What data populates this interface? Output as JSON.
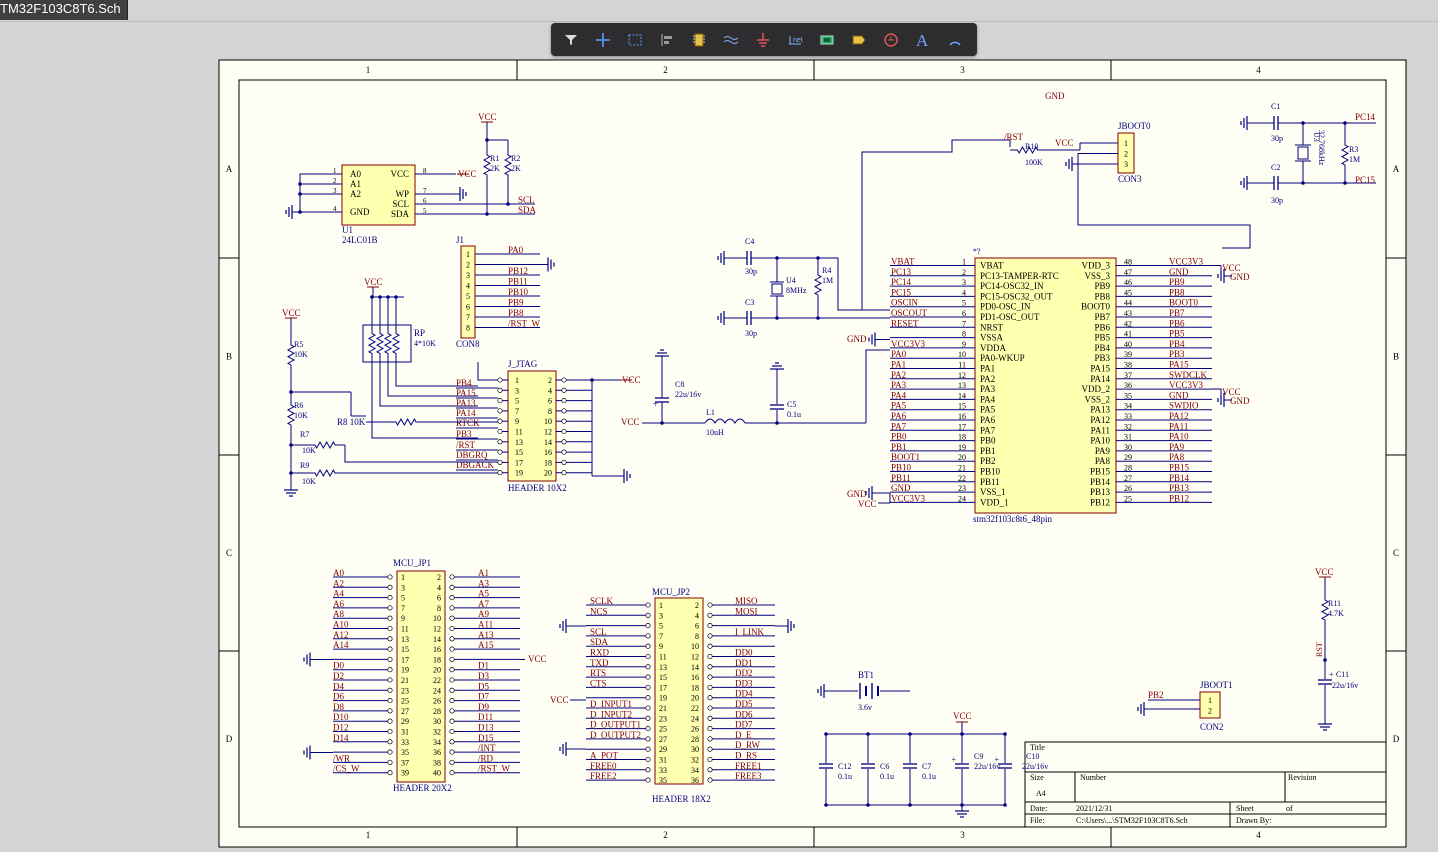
{
  "window": {
    "tab_title": "TM32F103C8T6.Sch"
  },
  "toolbar": {
    "tools": [
      {
        "name": "filter",
        "icon": "filter-icon"
      },
      {
        "name": "place-cross",
        "icon": "crosshair-icon"
      },
      {
        "name": "select-area",
        "icon": "select-rect-icon"
      },
      {
        "name": "align",
        "icon": "align-icon"
      },
      {
        "name": "place-part",
        "icon": "component-icon"
      },
      {
        "name": "place-harness",
        "icon": "signal-harness-icon"
      },
      {
        "name": "place-ground",
        "icon": "ground-icon"
      },
      {
        "name": "place-net-label",
        "icon": "net-label-icon"
      },
      {
        "name": "place-sheet-symbol",
        "icon": "sheet-symbol-icon"
      },
      {
        "name": "place-port",
        "icon": "port-icon"
      },
      {
        "name": "no-erc",
        "icon": "no-erc-icon"
      },
      {
        "name": "place-text",
        "icon": "text-icon"
      },
      {
        "name": "place-arc",
        "icon": "arc-icon"
      }
    ]
  },
  "sheet": {
    "colors": {
      "paper": "#fffef4",
      "border": "#000000",
      "wire": "#000080",
      "part_fill": "#ffffb0",
      "part_text": "#000080",
      "net_text": "#800000",
      "designator": "#000080"
    },
    "zone_columns": [
      "1",
      "2",
      "3",
      "4"
    ],
    "zone_rows": [
      "A",
      "B",
      "C",
      "D"
    ],
    "title_block": {
      "title_label": "Title",
      "size_label": "Size",
      "size_value": "A4",
      "number_label": "Number",
      "revision_label": "Revision",
      "date_label": "Date:",
      "date_value": "2021/12/31",
      "sheet_label": "Sheet",
      "of_label": "of",
      "file_label": "File:",
      "file_value": "C:\\Users\\...\\STM32F103C8T6.Sch",
      "drawn_label": "Drawn By:"
    },
    "labels": {
      "gnd_top": "GND",
      "u1_pins_left": [
        {
          "n": "1",
          "s": "A0"
        },
        {
          "n": "2",
          "s": "A1"
        },
        {
          "n": "3",
          "s": "A2"
        },
        {
          "n": "4",
          "s": "GND"
        }
      ],
      "u1_pins_right": [
        {
          "n": "8",
          "s": "VCC"
        },
        {
          "n": "7",
          "s": "WP"
        },
        {
          "n": "6",
          "s": "SCL"
        },
        {
          "n": "5",
          "s": "SDA"
        }
      ],
      "u1_ref": "U1",
      "u1_value": "24LC01B",
      "vcc": "VCC",
      "r1": "R1",
      "r1_val": "2K",
      "r2": "R2",
      "r2_val": "2K",
      "scl": "SCL",
      "sda": "SDA",
      "j1": "J1",
      "j1_value": "CON8",
      "j1_nets": [
        "PA0",
        "PB12",
        "PB11",
        "PB10",
        "PB9",
        "PB8",
        "/RST_W"
      ],
      "j1_pins": [
        "1",
        "2",
        "3",
        "4",
        "5",
        "6",
        "7",
        "8"
      ],
      "rp": "RP",
      "rp_val": "4*10K",
      "r5": "R5",
      "r5_val": "10K",
      "r6": "R6",
      "r6_val": "10K",
      "r7": "R7",
      "r7_val": "10K",
      "r8": "R8",
      "r8_val": "10K",
      "r9": "R9",
      "r9_val": "10K",
      "jtag": "J_JTAG",
      "jtag_value": "HEADER 10X2",
      "jtag_left_pins": [
        "1",
        "3",
        "5",
        "7",
        "9",
        "11",
        "13",
        "15",
        "17",
        "19"
      ],
      "jtag_right_pins": [
        "2",
        "4",
        "6",
        "8",
        "10",
        "12",
        "14",
        "16",
        "18",
        "20"
      ],
      "jtag_nets": [
        "PB4",
        "PA15",
        "PA13",
        "PA14",
        "RTCK",
        "PB3",
        "/RST",
        "DBGRQ",
        "DBGACK"
      ],
      "c4": "C4",
      "c4_val": "30p",
      "c3": "C3",
      "c3_val": "30p",
      "u4": "U4",
      "u4_val": "8MHz",
      "r4": "R4",
      "r4_val": "1M",
      "c8": "C8",
      "c8_val": "22u/16v",
      "l1": "L1",
      "l1_val": "10uH",
      "c5": "C5",
      "c5_val": "0.1u",
      "rst_top": "/RST",
      "r10": "R10",
      "r10_val": "100K",
      "jboot0": "JBOOT0",
      "jboot0_value": "CON3",
      "jboot0_pins": [
        "1",
        "2",
        "3"
      ],
      "c1": "C1",
      "c1_val": "30p",
      "c2": "C2",
      "c2_val": "30p",
      "u3": "U3",
      "u3_val": "32.768kHz",
      "r3": "R3",
      "r3_val": "1M",
      "pc14": "PC14",
      "pc15": "PC15",
      "mcu_mark": "*?",
      "mcu_value": "stm32f103c8t6_48pin",
      "mcu_left": [
        {
          "n": "1",
          "s": "VBAT",
          "net": "VBAT"
        },
        {
          "n": "2",
          "s": "PC13-TAMPER-RTC",
          "net": "PC13"
        },
        {
          "n": "3",
          "s": "PC14-OSC32_IN",
          "net": "PC14"
        },
        {
          "n": "4",
          "s": "PC15-OSC32_OUT",
          "net": "PC15"
        },
        {
          "n": "5",
          "s": "PD0-OSC_IN",
          "net": "OSCIN"
        },
        {
          "n": "6",
          "s": "PD1-OSC_OUT",
          "net": "OSCOUT"
        },
        {
          "n": "7",
          "s": "NRST",
          "net": "RESET"
        },
        {
          "n": "8",
          "s": "VSSA",
          "net": ""
        },
        {
          "n": "9",
          "s": "VDDA",
          "net": "VCC3V3"
        },
        {
          "n": "10",
          "s": "PA0-WKUP",
          "net": "PA0"
        },
        {
          "n": "11",
          "s": "PA1",
          "net": "PA1"
        },
        {
          "n": "12",
          "s": "PA2",
          "net": "PA2"
        },
        {
          "n": "13",
          "s": "PA3",
          "net": "PA3"
        },
        {
          "n": "14",
          "s": "PA4",
          "net": "PA4"
        },
        {
          "n": "15",
          "s": "PA5",
          "net": "PA5"
        },
        {
          "n": "16",
          "s": "PA6",
          "net": "PA6"
        },
        {
          "n": "17",
          "s": "PA7",
          "net": "PA7"
        },
        {
          "n": "18",
          "s": "PB0",
          "net": "PB0"
        },
        {
          "n": "19",
          "s": "PB1",
          "net": "PB1"
        },
        {
          "n": "20",
          "s": "PB2",
          "net": "BOOT1"
        },
        {
          "n": "21",
          "s": "PB10",
          "net": "PB10"
        },
        {
          "n": "22",
          "s": "PB11",
          "net": "PB11"
        },
        {
          "n": "23",
          "s": "VSS_1",
          "net": "GND"
        },
        {
          "n": "24",
          "s": "VDD_1",
          "net": "VCC3V3"
        }
      ],
      "mcu_right": [
        {
          "n": "48",
          "s": "VDD_3",
          "net": "VCC3V3"
        },
        {
          "n": "47",
          "s": "VSS_3",
          "net": "GND"
        },
        {
          "n": "46",
          "s": "PB9",
          "net": "PB9"
        },
        {
          "n": "45",
          "s": "PB8",
          "net": "PB8"
        },
        {
          "n": "44",
          "s": "BOOT0",
          "net": "BOOT0"
        },
        {
          "n": "43",
          "s": "PB7",
          "net": "PB7"
        },
        {
          "n": "42",
          "s": "PB6",
          "net": "PB6"
        },
        {
          "n": "41",
          "s": "PB5",
          "net": "PB5"
        },
        {
          "n": "40",
          "s": "PB4",
          "net": "PB4"
        },
        {
          "n": "39",
          "s": "PB3",
          "net": "PB3"
        },
        {
          "n": "38",
          "s": "PA15",
          "net": "PA15"
        },
        {
          "n": "37",
          "s": "PA14",
          "net": "SWDCLK"
        },
        {
          "n": "36",
          "s": "VDD_2",
          "net": "VCC3V3"
        },
        {
          "n": "35",
          "s": "VSS_2",
          "net": "GND"
        },
        {
          "n": "34",
          "s": "PA13",
          "net": "SWDIO"
        },
        {
          "n": "33",
          "s": "PA12",
          "net": "PA12"
        },
        {
          "n": "32",
          "s": "PA11",
          "net": "PA11"
        },
        {
          "n": "31",
          "s": "PA10",
          "net": "PA10"
        },
        {
          "n": "30",
          "s": "PA9",
          "net": "PA9"
        },
        {
          "n": "29",
          "s": "PA8",
          "net": "PA8"
        },
        {
          "n": "28",
          "s": "PB15",
          "net": "PB15"
        },
        {
          "n": "27",
          "s": "PB14",
          "net": "PB14"
        },
        {
          "n": "26",
          "s": "PB13",
          "net": "PB13"
        },
        {
          "n": "25",
          "s": "PB12",
          "net": "PB12"
        }
      ],
      "gnd": "GND",
      "vcc_gnd_a": "VCC",
      "gnd_a": "GND",
      "mcu_jp1": "MCU_JP1",
      "mcu_jp1_value": "HEADER 20X2",
      "jp1_left_nets": [
        "A0",
        "A2",
        "A4",
        "A6",
        "A8",
        "A10",
        "A12",
        "A14",
        "",
        "D0",
        "D2",
        "D4",
        "D6",
        "D8",
        "D10",
        "D12",
        "D14",
        "",
        "/WR",
        "/CS_W"
      ],
      "jp1_right_nets": [
        "A1",
        "A3",
        "A5",
        "A7",
        "A9",
        "A11",
        "A13",
        "A15",
        "",
        "D1",
        "D3",
        "D5",
        "D7",
        "D9",
        "D11",
        "D13",
        "D15",
        "/INT",
        "/RD",
        "/RST_W"
      ],
      "jp1_left_pins": [
        "1",
        "3",
        "5",
        "7",
        "9",
        "11",
        "13",
        "15",
        "17",
        "19",
        "21",
        "23",
        "25",
        "27",
        "29",
        "31",
        "33",
        "35",
        "37",
        "39"
      ],
      "jp1_right_pins": [
        "2",
        "4",
        "6",
        "8",
        "10",
        "12",
        "14",
        "16",
        "18",
        "20",
        "22",
        "24",
        "26",
        "28",
        "30",
        "32",
        "34",
        "36",
        "38",
        "40"
      ],
      "mcu_jp2": "MCU_JP2",
      "mcu_jp2_value": "HEADER 18X2",
      "jp2_left_nets": [
        "SCLK",
        "NCS",
        "",
        "SCL",
        "SDA",
        "RXD",
        "TXD",
        "RTS",
        "CTS",
        "",
        "D_INPUT1",
        "D_INPUT2",
        "D_OUTPUT1",
        "D_OUTPUT2",
        "",
        "A_POT",
        "FREE0",
        "FREE2"
      ],
      "jp2_right_nets": [
        "MISO",
        "MOSI",
        "",
        "I_LINK",
        "",
        "DD0",
        "DD1",
        "DD2",
        "DD3",
        "DD4",
        "DD5",
        "DD6",
        "DD7",
        "D_E",
        "D_RW",
        "D_RS",
        "FREE1",
        "FREE3"
      ],
      "jp2_left_pins": [
        "1",
        "3",
        "5",
        "7",
        "9",
        "11",
        "13",
        "15",
        "17",
        "19",
        "21",
        "23",
        "25",
        "27",
        "29",
        "31",
        "33",
        "35"
      ],
      "jp2_right_pins": [
        "2",
        "4",
        "6",
        "8",
        "10",
        "12",
        "14",
        "16",
        "18",
        "20",
        "22",
        "24",
        "26",
        "28",
        "30",
        "32",
        "34",
        "36"
      ],
      "bt1": "BT1",
      "bt1_val": "3.6v",
      "c12": "C12",
      "c12_val": "0.1u",
      "c6": "C6",
      "c6_val": "0.1u",
      "c7": "C7",
      "c7_val": "0.1u",
      "c9": "C9",
      "c9_val": "22u/16v",
      "c10": "C10",
      "c10_val": "22u/16v",
      "pb2": "PB2",
      "jboot1": "JBOOT1",
      "jboot1_value": "CON2",
      "jboot1_pins": [
        "1",
        "2"
      ],
      "r11": "R11",
      "r11_val": "4.7K",
      "rst_r": "RST",
      "c11": "C11",
      "c11_val": "22u/16v"
    }
  }
}
